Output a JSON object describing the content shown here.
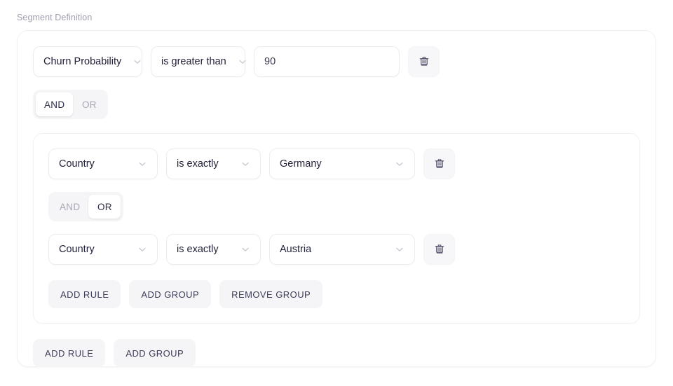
{
  "section": {
    "label": "Segment Definition"
  },
  "root_group": {
    "conjunction": {
      "options": [
        "AND",
        "OR"
      ],
      "selected": "AND"
    },
    "rules": [
      {
        "field": "Churn Probability",
        "operator": "is greater than",
        "value": "90",
        "value_kind": "text-input",
        "delete_icon": "trash-icon"
      }
    ],
    "actions": [
      {
        "label": "ADD RULE",
        "name": "add-rule-button"
      },
      {
        "label": "ADD GROUP",
        "name": "add-group-button"
      }
    ]
  },
  "nested_group": {
    "conjunction": {
      "options": [
        "AND",
        "OR"
      ],
      "selected": "OR"
    },
    "rules": [
      {
        "field": "Country",
        "operator": "is exactly",
        "value": "Germany",
        "value_kind": "select",
        "delete_icon": "trash-icon"
      },
      {
        "field": "Country",
        "operator": "is exactly",
        "value": "Austria",
        "value_kind": "select",
        "delete_icon": "trash-icon"
      }
    ],
    "actions": [
      {
        "label": "ADD RULE",
        "name": "add-rule-button"
      },
      {
        "label": "ADD GROUP",
        "name": "add-group-button"
      },
      {
        "label": "REMOVE GROUP",
        "name": "remove-group-button"
      }
    ]
  },
  "icons": {
    "chevron": "chevron-down-icon",
    "trash": "trash-icon"
  },
  "colors": {
    "page_background": "#ffffff",
    "card_border": "#f1f1f4",
    "control_border": "#ececf0",
    "toggle_track": "#f5f5f7",
    "button_background": "#f5f5f7",
    "text_primary": "#22223a",
    "text_muted": "#9e9eae",
    "icon_muted": "#c7c7d2",
    "trash_icon": "#4b4b66"
  }
}
